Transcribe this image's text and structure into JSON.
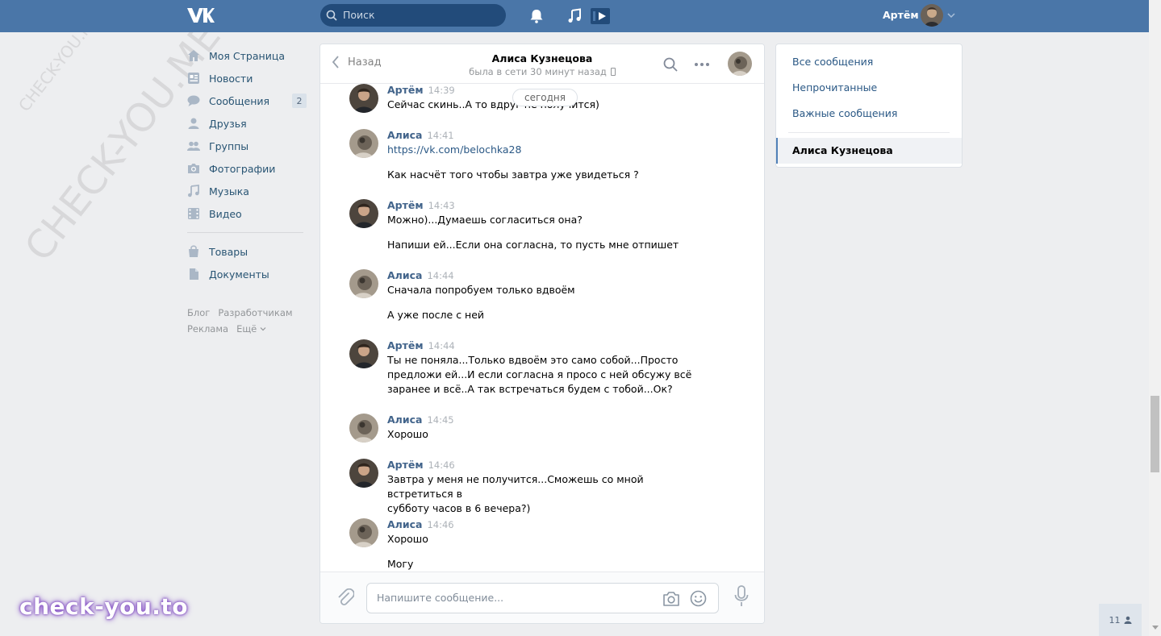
{
  "header": {
    "search_placeholder": "Поиск",
    "user_name": "Артём",
    "accent": "#4a76a8"
  },
  "sidebar": {
    "items": [
      {
        "label": "Моя Страница",
        "icon": "home-icon"
      },
      {
        "label": "Новости",
        "icon": "news-icon"
      },
      {
        "label": "Сообщения",
        "icon": "messages-icon",
        "badge": "2"
      },
      {
        "label": "Друзья",
        "icon": "friends-icon"
      },
      {
        "label": "Группы",
        "icon": "groups-icon"
      },
      {
        "label": "Фотографии",
        "icon": "camera-icon"
      },
      {
        "label": "Музыка",
        "icon": "music-icon"
      },
      {
        "label": "Видео",
        "icon": "video-icon"
      },
      {
        "label": "Товары",
        "icon": "bag-icon"
      },
      {
        "label": "Документы",
        "icon": "document-icon"
      }
    ],
    "footer": [
      "Блог",
      "Разработчикам",
      "Реклама",
      "Ещё"
    ]
  },
  "chat": {
    "back_label": "Назад",
    "title": "Алиса Кузнецова",
    "subtitle": "была в сети 30 минут назад",
    "date_label": "сегодня",
    "messages": [
      {
        "author": "Артём",
        "time": "14:39",
        "lines": [
          "Сейчас скинь..А то вдруг не получится)"
        ]
      },
      {
        "author": "Алиса",
        "time": "14:41",
        "lines": [
          "https://vk.com/belochka28",
          "Как насчёт того чтобы завтра уже увидеться ?"
        ]
      },
      {
        "author": "Артём",
        "time": "14:43",
        "lines": [
          "Можно)...Думаешь согласиться она?",
          "Напиши ей...Если она согласна, то пусть мне отпишет"
        ]
      },
      {
        "author": "Алиса",
        "time": "14:44",
        "lines": [
          "Сначала попробуем только вдвоём",
          "А уже после с ней"
        ]
      },
      {
        "author": "Артём",
        "time": "14:44",
        "lines": [
          "Ты не поняла...Только вдвоём это само собой...Просто\nпредложи ей...И если согласна я просо с ней обсужу всё\nзаранее и всё..А так встречаться будем с тобой...Ок?"
        ]
      },
      {
        "author": "Алиса",
        "time": "14:45",
        "lines": [
          "Хорошо"
        ]
      },
      {
        "author": "Артём",
        "time": "14:46",
        "lines": [
          "Завтра у меня не получится...Сможешь со мной встретиться в\nсубботу часов в 6 вечера?)"
        ]
      },
      {
        "author": "Алиса",
        "time": "14:46",
        "lines": [
          "Хорошо",
          "Могу"
        ]
      }
    ],
    "input_placeholder": "Напишите сообщение..."
  },
  "rightnav": {
    "all": "Все сообщения",
    "unread": "Непрочитанные",
    "important": "Важные сообщения",
    "active": "Алиса Кузнецова"
  },
  "widget": {
    "friends_online": "11"
  },
  "watermarks": {
    "big": "CHECK-YOU.ME",
    "small": "CHECK-YOU.ME",
    "brand": "check-you.to"
  }
}
